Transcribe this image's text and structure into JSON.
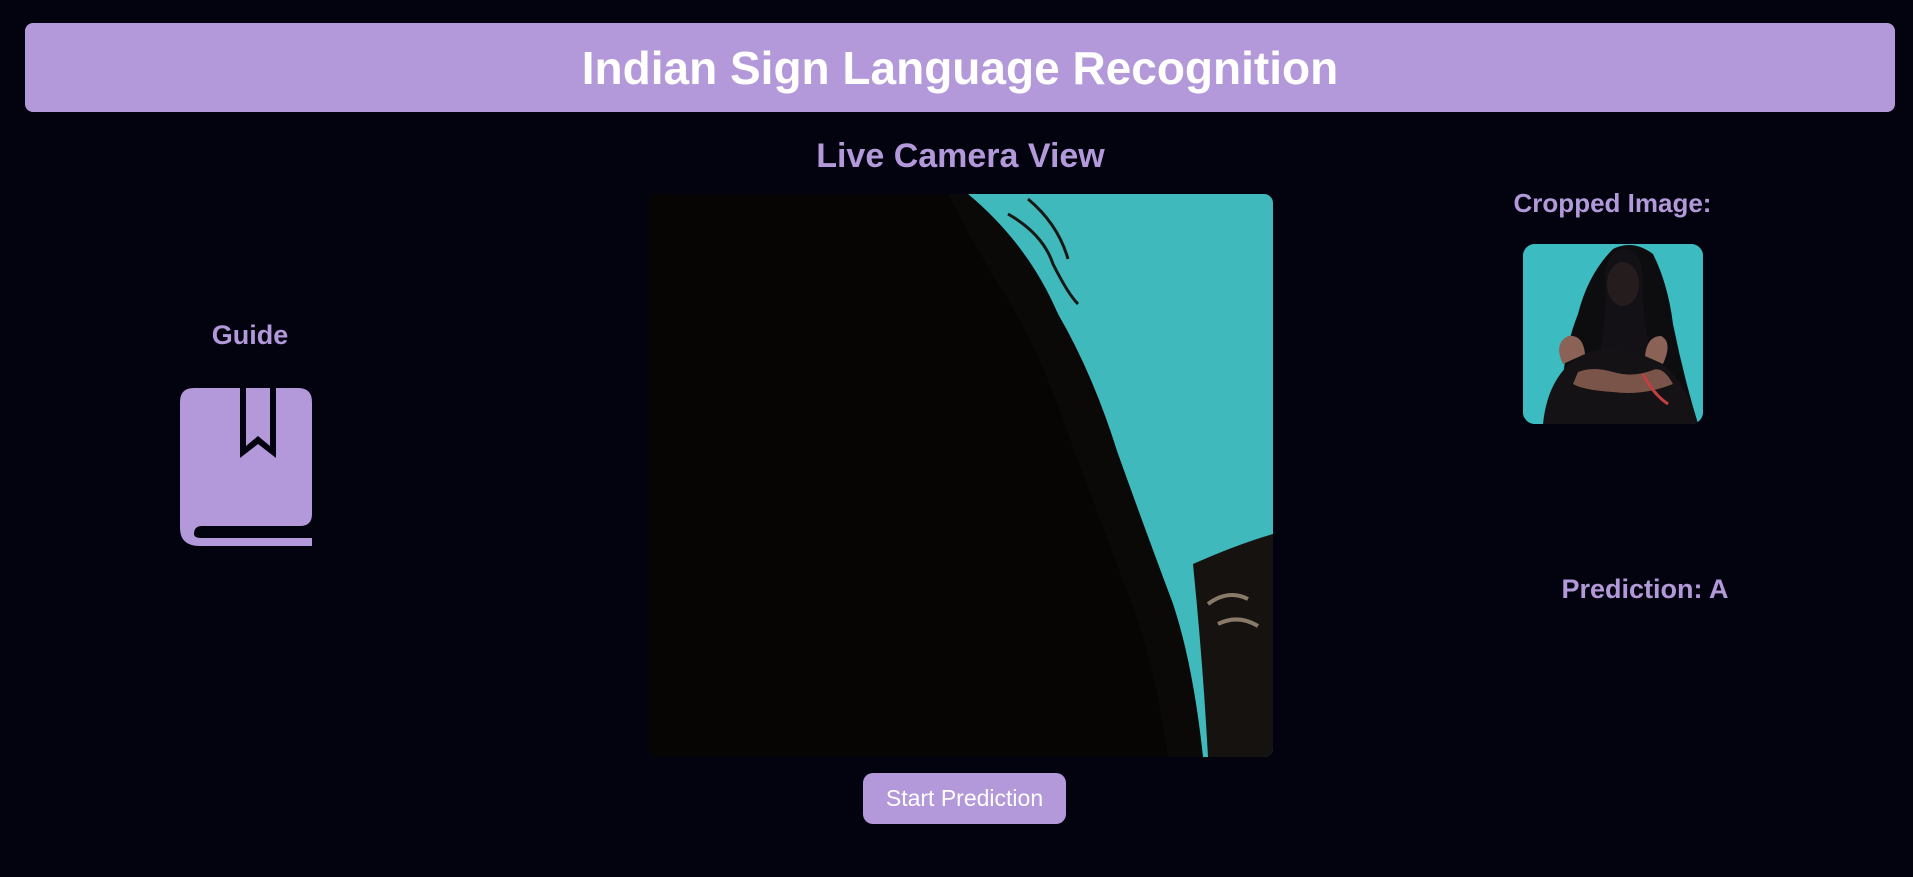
{
  "app": {
    "title": "Indian Sign Language Recognition"
  },
  "guide": {
    "label": "Guide",
    "icon": "book-bookmark-icon"
  },
  "camera": {
    "title": "Live Camera View",
    "start_button_label": "Start Prediction"
  },
  "cropped": {
    "label": "Cropped Image:"
  },
  "prediction": {
    "text": "Prediction: A"
  },
  "colors": {
    "background": "#03030f",
    "accent": "#b399d9",
    "header_text": "#ffffff"
  }
}
